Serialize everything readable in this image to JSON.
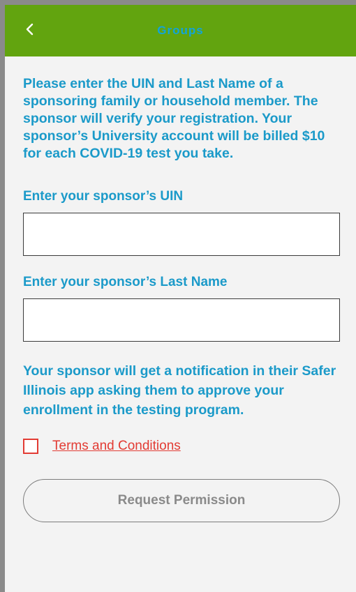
{
  "header": {
    "back_icon": "chevron-left-icon",
    "title": "Groups"
  },
  "intro_text": "Please enter the UIN and Last Name of a sponsoring family or household member. The sponsor will verify your registration. Your sponsor’s University account will be billed $10 for each COVID-19 test you take.",
  "uin_field": {
    "label": "Enter your sponsor’s UIN",
    "value": ""
  },
  "last_name_field": {
    "label": "Enter your sponsor’s Last Name",
    "value": ""
  },
  "notification_text": "Your sponsor will get a notification in their Safer Illinois app asking them to approve your enrollment in the testing program.",
  "terms": {
    "checked": false,
    "link_label": "Terms and Conditions"
  },
  "request_button_label": "Request Permission",
  "colors": {
    "header_bg": "#62a40f",
    "text_accent": "#1b9ac9",
    "terms_red": "#e23b33"
  }
}
